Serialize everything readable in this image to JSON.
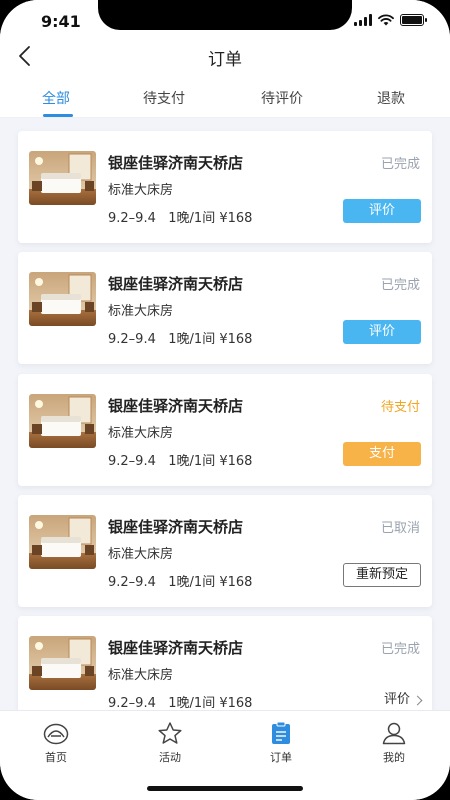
{
  "status_bar": {
    "time": "9:41"
  },
  "header": {
    "title": "订单"
  },
  "tabs": [
    {
      "label": "全部",
      "active": true
    },
    {
      "label": "待支付",
      "active": false
    },
    {
      "label": "待评价",
      "active": false
    },
    {
      "label": "退款",
      "active": false
    }
  ],
  "orders": [
    {
      "hotel": "银座佳驿济南天桥店",
      "room": "标准大床房",
      "dates": "9.2–9.4",
      "nights": "1晚/1间",
      "price": "¥168",
      "status": "已完成",
      "status_color": "#9aa3b0",
      "action": "评价",
      "action_style": "blue"
    },
    {
      "hotel": "银座佳驿济南天桥店",
      "room": "标准大床房",
      "dates": "9.2–9.4",
      "nights": "1晚/1间",
      "price": "¥168",
      "status": "已完成",
      "status_color": "#9aa3b0",
      "action": "评价",
      "action_style": "blue"
    },
    {
      "hotel": "银座佳驿济南天桥店",
      "room": "标准大床房",
      "dates": "9.2–9.4",
      "nights": "1晚/1间",
      "price": "¥168",
      "status": "待支付",
      "status_color": "#f2a623",
      "action": "支付",
      "action_style": "orange"
    },
    {
      "hotel": "银座佳驿济南天桥店",
      "room": "标准大床房",
      "dates": "9.2–9.4",
      "nights": "1晚/1间",
      "price": "¥168",
      "status": "已取消",
      "status_color": "#9aa3b0",
      "action": "重新预定",
      "action_style": "outline"
    },
    {
      "hotel": "银座佳驿济南天桥店",
      "room": "标准大床房",
      "dates": "9.2–9.4",
      "nights": "1晚/1间",
      "price": "¥168",
      "status": "已完成",
      "status_color": "#9aa3b0",
      "action": "评价",
      "action_style": "link"
    }
  ],
  "tabbar": [
    {
      "label": "首页",
      "icon": "home-icon"
    },
    {
      "label": "活动",
      "icon": "star-icon"
    },
    {
      "label": "订单",
      "icon": "order-icon",
      "active": true
    },
    {
      "label": "我的",
      "icon": "user-icon"
    }
  ],
  "colors": {
    "accent": "#2e8ddf",
    "pay": "#f7b248",
    "review": "#49b6f2"
  }
}
